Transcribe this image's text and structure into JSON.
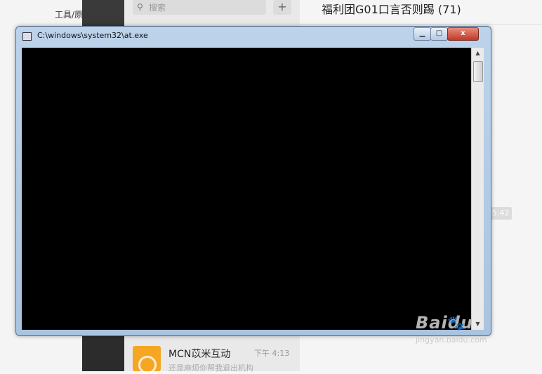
{
  "app": {
    "left_label": "工具/原",
    "search_placeholder": "搜索",
    "plus_label": "+",
    "chat_title": "福利团G01口言否则踢 (71)",
    "time_badge": "5:42",
    "mcn": {
      "name": "MCN苡米互动",
      "time": "下午 4:13",
      "preview": "还是麻烦你帮我退出机构"
    }
  },
  "console": {
    "title": "C:\\windows\\system32\\at.exe",
    "minimize_glyph": "▁",
    "maximize_glyph": "□",
    "close_glyph": "x",
    "scroll_up": "▲",
    "scroll_down": "▼"
  },
  "icons": {
    "search": "search-icon",
    "console": "console-icon"
  },
  "watermark": {
    "main": "Baidu",
    "sub": "jingyan.baidu.com",
    "paw": "🐾"
  },
  "colors": {
    "console_frame": "#a9c4e0",
    "close_button": "#c0392b",
    "console_background": "#000000"
  }
}
